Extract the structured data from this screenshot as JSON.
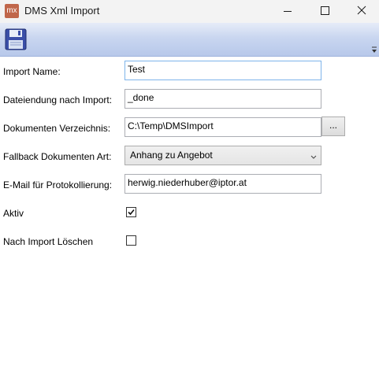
{
  "window": {
    "app_icon_text": "mx",
    "title": "DMS Xml Import"
  },
  "toolbar": {
    "save_icon": "floppy-disk-icon"
  },
  "form": {
    "import_name": {
      "label": "Import Name:",
      "value": "Test"
    },
    "file_ending": {
      "label": "Dateiendung nach Import:",
      "value": "_done"
    },
    "documents_dir": {
      "label": "Dokumenten Verzeichnis:",
      "value": "C:\\Temp\\DMSImport",
      "browse_label": "..."
    },
    "fallback_type": {
      "label": "Fallback Dokumenten Art:",
      "value": "Anhang zu Angebot"
    },
    "email": {
      "label": "E-Mail für Protokollierung:",
      "value": "herwig.niederhuber@iptor.at"
    },
    "active": {
      "label": "Aktiv",
      "checked": true
    },
    "delete_after": {
      "label": "Nach Import Löschen",
      "checked": false
    }
  },
  "colors": {
    "ribbon_accent": "#b7c8ea",
    "focus_border": "#7eb4ea",
    "app_icon_bg": "#c0664a"
  }
}
